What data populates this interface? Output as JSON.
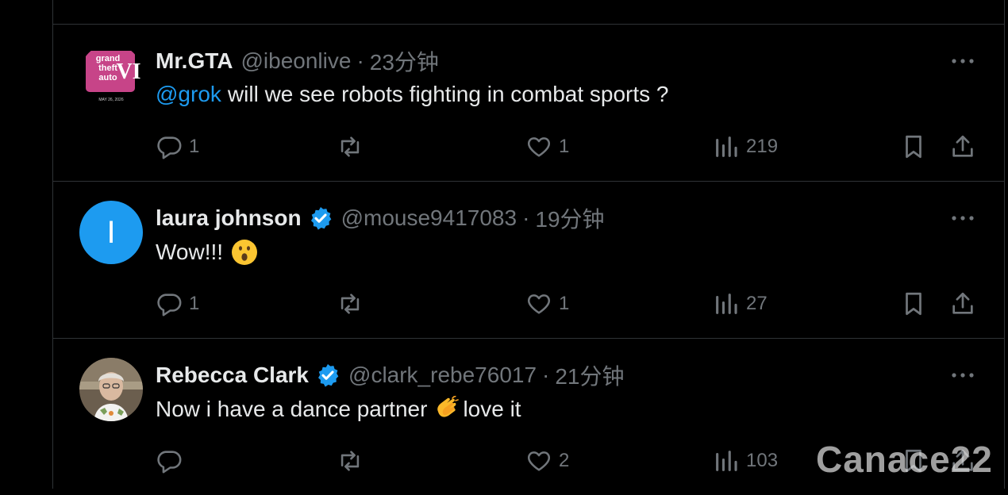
{
  "tweets": [
    {
      "name": "Mr.GTA",
      "verified": false,
      "handle": "@ibeonlive",
      "time": "23分钟",
      "mention": "@grok",
      "text": "will we see robots fighting in combat sports ?",
      "emoji": "",
      "text_after": "",
      "avatar_lines": [
        "grand",
        "theft",
        "auto"
      ],
      "avatar_date": "MAY 26, 2026",
      "replies": "1",
      "retweets": "",
      "likes": "1",
      "views": "219"
    },
    {
      "name": "laura johnson",
      "verified": true,
      "handle": "@mouse9417083",
      "time": "19分钟",
      "mention": "",
      "text": "Wow!!!",
      "emoji": "astonished-face",
      "text_after": "",
      "avatar_letter": "I",
      "replies": "1",
      "retweets": "",
      "likes": "1",
      "views": "27"
    },
    {
      "name": "Rebecca Clark",
      "verified": true,
      "handle": "@clark_rebe76017",
      "time": "21分钟",
      "mention": "",
      "text": "Now i have a dance partner",
      "emoji": "clapping-hands",
      "text_after": "love it",
      "replies": "",
      "retweets": "",
      "likes": "2",
      "views": "103"
    }
  ],
  "dot": "·",
  "watermark": "Canace22",
  "colors": {
    "background": "#000000",
    "text": "#e7e9ea",
    "muted": "#71767b",
    "accent": "#1d9bf0",
    "border": "#2f3336"
  }
}
